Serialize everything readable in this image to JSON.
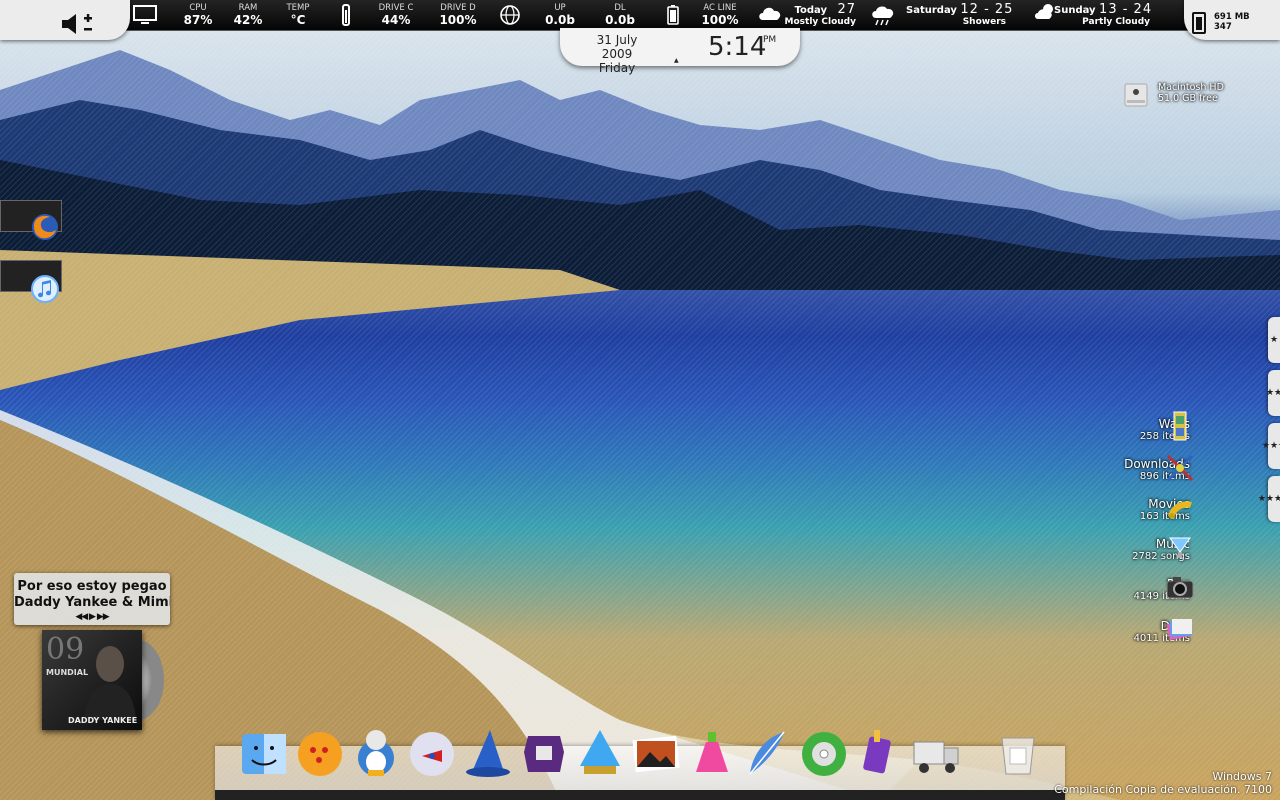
{
  "topbar": {
    "cpu": {
      "label": "CPU",
      "value": "87%"
    },
    "ram": {
      "label": "RAM",
      "value": "42%"
    },
    "temp": {
      "label": "TEMP",
      "value": "°C"
    },
    "drive_c": {
      "label": "DRIVE C",
      "value": "44%"
    },
    "drive_d": {
      "label": "DRIVE D",
      "value": "100%"
    },
    "up": {
      "label": "UP",
      "value": "0.0b"
    },
    "dl": {
      "label": "DL",
      "value": "0.0b"
    },
    "ac": {
      "label": "AC LINE",
      "value": "100%"
    },
    "weather": [
      {
        "day": "Today",
        "temps": "27",
        "cond": "Mostly Cloudy"
      },
      {
        "day": "Saturday",
        "temps": "12 - 25",
        "cond": "Showers"
      },
      {
        "day": "Sunday",
        "temps": "13 - 24",
        "cond": "Partly Cloudy"
      }
    ],
    "memory": {
      "line1": "691 MB",
      "line2": "347"
    }
  },
  "clock": {
    "date": "31 July 2009",
    "weekday": "Friday",
    "time": "5:14",
    "ampm": "PM"
  },
  "drive": {
    "name": "Macintosh HD",
    "free": "51.0 GB free"
  },
  "stacks": [
    {
      "name": "Walls",
      "count": "258 items"
    },
    {
      "name": "Downloads",
      "count": "896 items"
    },
    {
      "name": "Movies",
      "count": "163 items"
    },
    {
      "name": "Music",
      "count": "2782 songs"
    },
    {
      "name": "Pics",
      "count": "4149 items"
    },
    {
      "name": "Docs",
      "count": "4011 items"
    }
  ],
  "side_tabs": [
    "★",
    "★★",
    "★★★",
    "★★★★"
  ],
  "music": {
    "line1": "Por eso estoy pegao",
    "line2": "Daddy Yankee & Mimi",
    "controls": "◀◀ ▶ ▶▶",
    "album_num": "09",
    "album_text": "MUNDIAL",
    "album_artist": "DADDY YANKEE"
  },
  "watermark": {
    "line1": "Windows 7",
    "line2": "Compilación Copia de evaluación. 7100"
  },
  "dock": [
    "finder-icon",
    "dragonball-icon",
    "penguin-icon",
    "ball-icon",
    "wizard-hat-icon",
    "purple-app-icon",
    "crystal-icon",
    "photo-icon",
    "potion-icon",
    "feather-icon",
    "disc-icon",
    "paint-icon",
    "truck-icon",
    "trash-icon"
  ],
  "colors": {
    "bar": "#0a0a0a",
    "panel": "#ececec",
    "accent": "#2a55b8"
  }
}
